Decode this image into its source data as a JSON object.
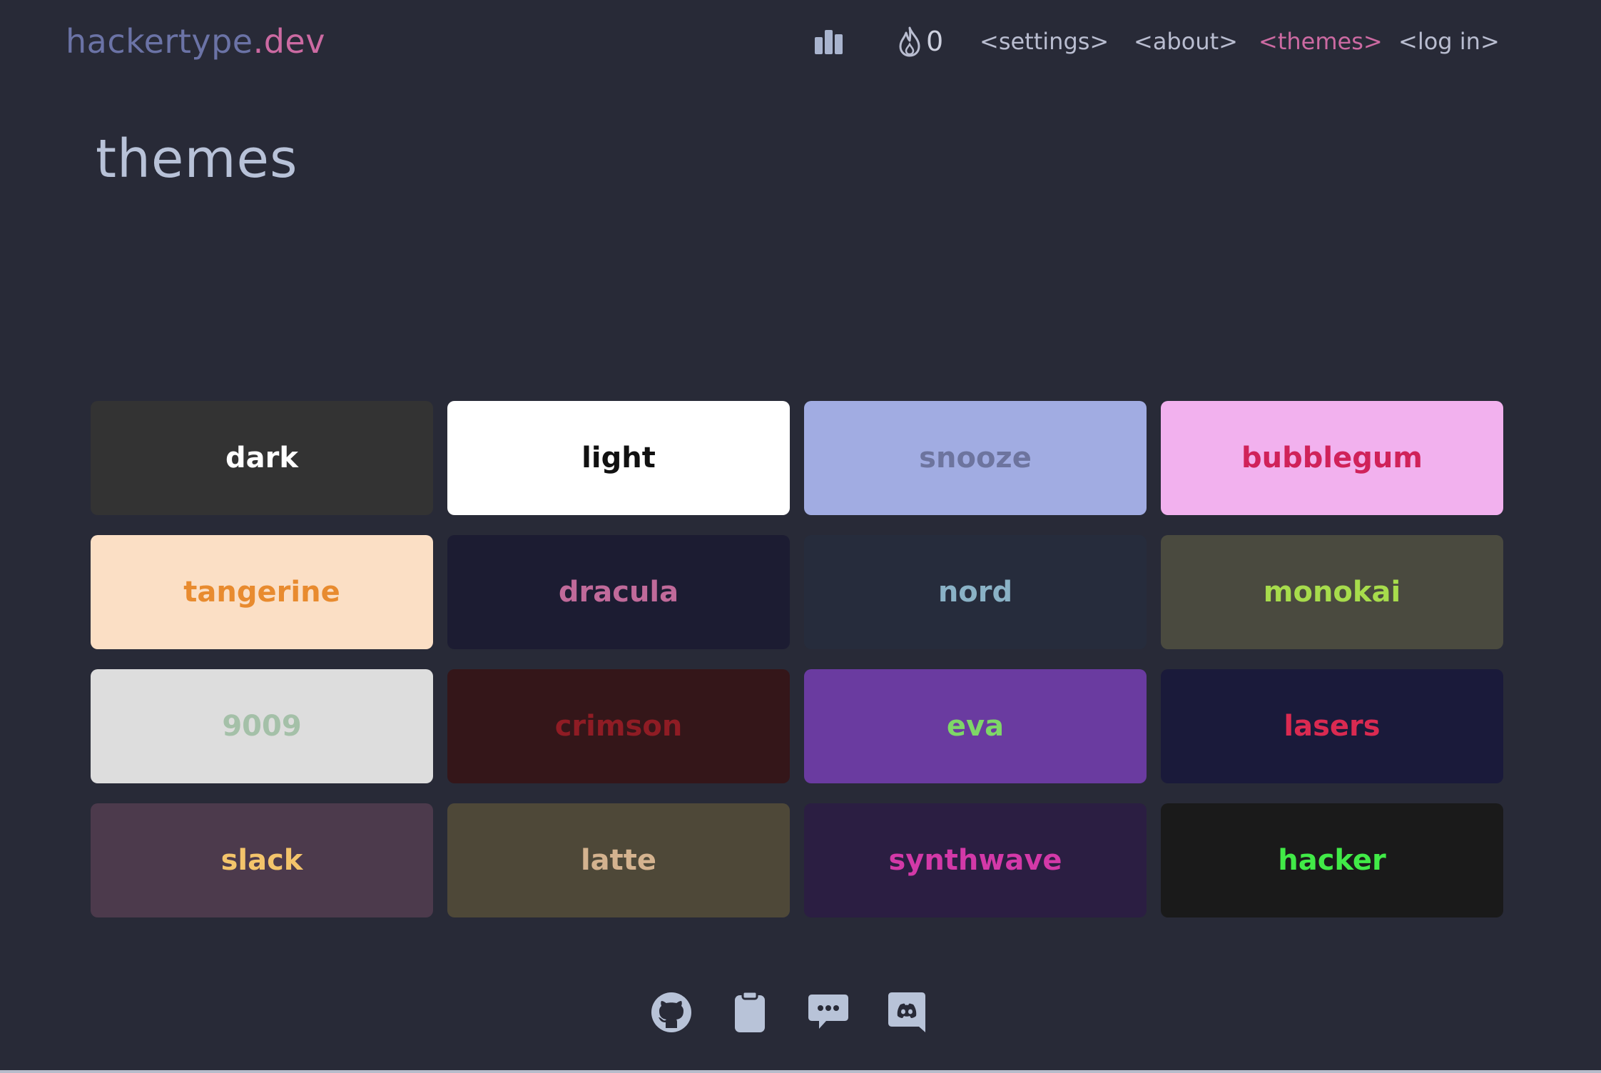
{
  "brand": {
    "part1": "hackertype",
    "part2": ".dev"
  },
  "nav": {
    "leaderboard_icon": "bar-chart-icon",
    "streak_icon": "flame-icon",
    "streak_count": "0",
    "settings": "<settings>",
    "about": "<about>",
    "themes": "<themes>",
    "login": "<log in>"
  },
  "page": {
    "title": "themes"
  },
  "themes": [
    {
      "name": "dark",
      "bg": "#333333",
      "fg": "#ffffff"
    },
    {
      "name": "light",
      "bg": "#ffffff",
      "fg": "#111111"
    },
    {
      "name": "snooze",
      "bg": "#a1ace2",
      "fg": "#6d749e"
    },
    {
      "name": "bubblegum",
      "bg": "#f2b1ee",
      "fg": "#d0225a"
    },
    {
      "name": "tangerine",
      "bg": "#fbdfc5",
      "fg": "#e88b2f"
    },
    {
      "name": "dracula",
      "bg": "#1c1c32",
      "fg": "#c06a9a"
    },
    {
      "name": "nord",
      "bg": "#262c3c",
      "fg": "#8ab2c6"
    },
    {
      "name": "monokai",
      "bg": "#4a4a3f",
      "fg": "#a7dc4c"
    },
    {
      "name": "9009",
      "bg": "#dddddd",
      "fg": "#a4c0a8"
    },
    {
      "name": "crimson",
      "bg": "#341619",
      "fg": "#8f1c24"
    },
    {
      "name": "eva",
      "bg": "#6a3ba0",
      "fg": "#7ed767"
    },
    {
      "name": "lasers",
      "bg": "#1a1a3a",
      "fg": "#da2a51"
    },
    {
      "name": "slack",
      "bg": "#4c3a4c",
      "fg": "#f3c46b"
    },
    {
      "name": "latte",
      "bg": "#4e4838",
      "fg": "#d4b38f"
    },
    {
      "name": "synthwave",
      "bg": "#2b1e42",
      "fg": "#d339a8"
    },
    {
      "name": "hacker",
      "bg": "#1a1a1a",
      "fg": "#41ea47"
    }
  ],
  "footer": {
    "icons": [
      "github-icon",
      "clipboard-icon",
      "chat-icon",
      "discord-icon"
    ]
  },
  "colors": {
    "background": "#282a37",
    "accent": "#cc6aa2",
    "muted": "#b9bdd0"
  }
}
